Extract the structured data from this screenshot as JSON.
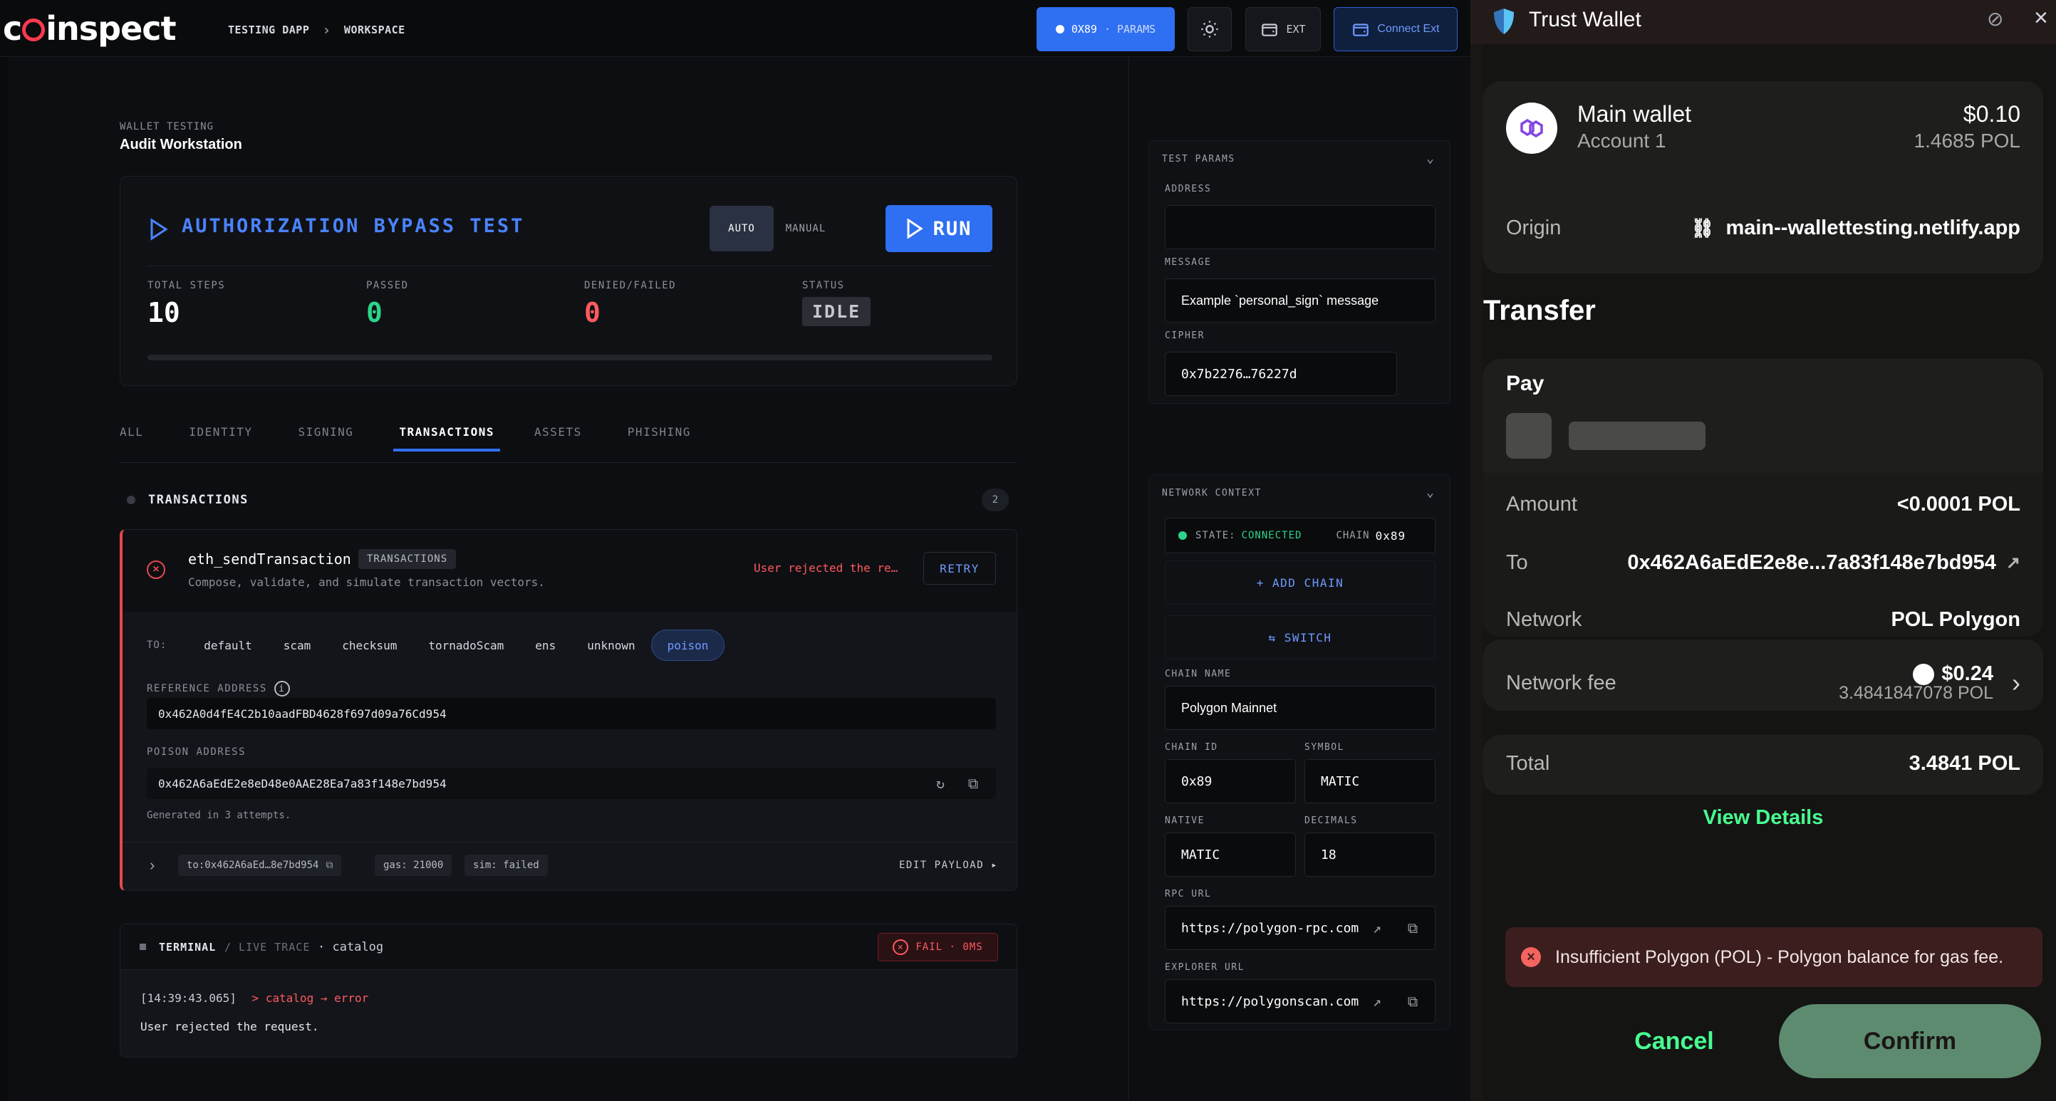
{
  "header": {
    "logo_text": "coinspect",
    "breadcrumb": [
      "TESTING DAPP",
      "WORKSPACE"
    ],
    "network_pill": "0X89",
    "network_pill_sub": "· PARAMS",
    "ext_label": "EXT",
    "connect_label": "Connect Ext"
  },
  "section": {
    "label": "WALLET TESTING",
    "title": "Audit Workstation"
  },
  "test": {
    "title": "AUTHORIZATION BYPASS TEST",
    "mode_auto": "AUTO",
    "mode_manual": "MANUAL",
    "run_label": "RUN",
    "stats": [
      {
        "label": "TOTAL STEPS",
        "value": "10"
      },
      {
        "label": "PASSED",
        "value": "0"
      },
      {
        "label": "DENIED/FAILED",
        "value": "0"
      },
      {
        "label": "STATUS",
        "value": "IDLE"
      }
    ],
    "progress": 0
  },
  "tabs": [
    "ALL",
    "IDENTITY",
    "SIGNING",
    "TRANSACTIONS",
    "ASSETS",
    "PHISHING"
  ],
  "active_tab": "TRANSACTIONS",
  "group": {
    "title": "TRANSACTIONS",
    "count": "2"
  },
  "transaction": {
    "method": "eth_sendTransaction",
    "badge": "TRANSACTIONS",
    "description": "Compose, validate, and simulate transaction vectors.",
    "error": "User rejected the re…",
    "retry_label": "RETRY",
    "to_label": "TO:",
    "targets": [
      "default",
      "scam",
      "checksum",
      "tornadoScam",
      "ens",
      "unknown",
      "poison"
    ],
    "active_target": "poison",
    "reference_label": "REFERENCE ADDRESS",
    "reference_address": "0x462A0d4fE4C2b10aadFBD4628f697d09a76Cd954",
    "poison_label": "POISON ADDRESS",
    "poison_address": "0x462A6aEdE2e8eD48e0AAE28Ea7a83f148e7bd954",
    "generated_note": "Generated in 3 attempts.",
    "meta_to": "to:0x462A6aEd…8e7bd954",
    "meta_gas": "gas: 21000",
    "meta_sim": "sim: failed",
    "edit_payload": "EDIT PAYLOAD ▸"
  },
  "terminal": {
    "title": "TERMINAL",
    "sub": "/ LIVE TRACE",
    "context": "· catalog",
    "status": "FAIL · 0MS",
    "log_time": "[14:39:43.065]",
    "log_event": "> catalog → error",
    "log_message": "User rejected the request."
  },
  "params": {
    "title": "TEST PARAMS",
    "address_label": "ADDRESS",
    "address_value": "",
    "message_label": "MESSAGE",
    "message_value": "Example `personal_sign` message",
    "cipher_label": "CIPHER",
    "cipher_value": "0x7b2276…76227d"
  },
  "network": {
    "title": "NETWORK CONTEXT",
    "state_label": "STATE:",
    "state_value": "CONNECTED",
    "chain_label": "CHAIN",
    "chain_value": "0x89",
    "add_chain": "+ ADD CHAIN",
    "switch": "⇆ SWITCH",
    "chain_name_label": "CHAIN NAME",
    "chain_name": "Polygon Mainnet",
    "chain_id_label": "CHAIN ID",
    "chain_id": "0x89",
    "symbol_label": "SYMBOL",
    "symbol": "MATIC",
    "native_label": "NATIVE",
    "native": "MATIC",
    "decimals_label": "DECIMALS",
    "decimals": "18",
    "rpc_label": "RPC URL",
    "rpc_url": "https://polygon-rpc.com",
    "explorer_label": "EXPLORER URL",
    "explorer_url": "https://polygonscan.com"
  },
  "wallet": {
    "app_name": "Trust Wallet",
    "account_name": "Main wallet",
    "account_sub": "Account 1",
    "balance_usd": "$0.10",
    "balance_pol": "1.4685 POL",
    "origin_label": "Origin",
    "origin_value": "main--wallettesting.netlify.app",
    "transfer_title": "Transfer",
    "pay_label": "Pay",
    "amount_label": "Amount",
    "amount_value": "<0.0001 POL",
    "to_label": "To",
    "to_value": "0x462A6aEdE2e8e...7a83f148e7bd954",
    "network_label": "Network",
    "network_value": "POL Polygon",
    "fee_label": "Network fee",
    "fee_usd": "$0.24",
    "fee_pol": "3.4841847078 POL",
    "total_label": "Total",
    "total_value": "3.4841 POL",
    "view_details": "View Details",
    "error": "Insufficient Polygon (POL) - Polygon balance for gas fee.",
    "cancel": "Cancel",
    "confirm": "Confirm"
  },
  "colors": {
    "accent": "#2f6ff2",
    "error": "#e5484d",
    "success": "#2bd48a",
    "tw_green": "#48ff91"
  }
}
